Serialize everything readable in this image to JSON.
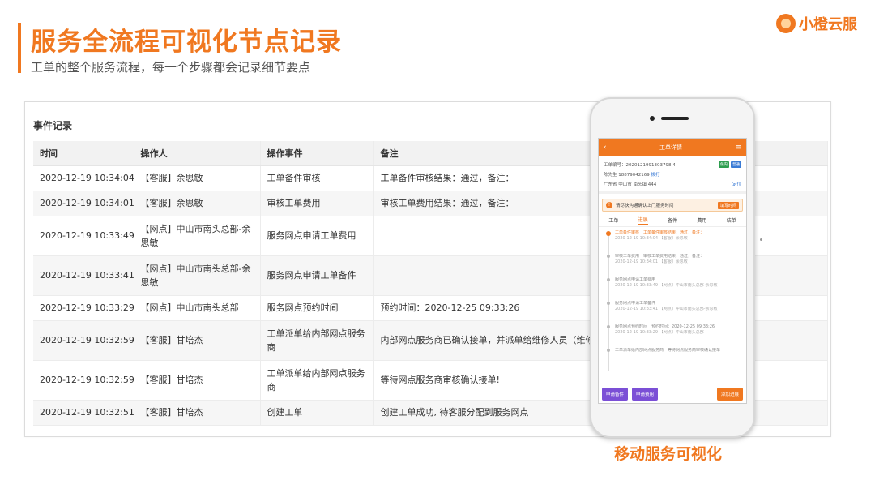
{
  "header": {
    "title": "服务全流程可视化节点记录",
    "subtitle": "工单的整个服务流程，每一个步骤都会记录细节要点",
    "brand": "小橙云服"
  },
  "events": {
    "title": "事件记录",
    "columns": [
      "时间",
      "操作人",
      "操作事件",
      "备注"
    ],
    "rows": [
      {
        "time": "2020-12-19 10:34:04",
        "operator": "【客服】余思敏",
        "event": "工单备件审核",
        "note": "工单备件审核结果：通过，备注："
      },
      {
        "time": "2020-12-19 10:34:01",
        "operator": "【客服】余思敏",
        "event": "审核工单费用",
        "note": "审核工单费用结果：通过，备注："
      },
      {
        "time": "2020-12-19 10:33:49",
        "operator": "【网点】中山市南头总部-余思敏",
        "event": "服务网点申请工单费用",
        "note": ""
      },
      {
        "time": "2020-12-19 10:33:41",
        "operator": "【网点】中山市南头总部-余思敏",
        "event": "服务网点申请工单备件",
        "note": ""
      },
      {
        "time": "2020-12-19 10:33:29",
        "operator": "【网点】中山市南头总部",
        "event": "服务网点预约时间",
        "note": "预约时间：2020-12-25 09:33:26"
      },
      {
        "time": "2020-12-19 10:32:59",
        "operator": "【客服】甘培杰",
        "event": "工单派单给内部网点服务商",
        "note": "内部网点服务商已确认接单，并派单给维修人员（维修"
      },
      {
        "time": "2020-12-19 10:32:59",
        "operator": "【客服】甘培杰",
        "event": "工单派单给内部网点服务商",
        "note": "等待网点服务商审核确认接单!"
      },
      {
        "time": "2020-12-19 10:32:51",
        "operator": "【客服】甘培杰",
        "event": "创建工单",
        "note": "创建工单成功, 待客服分配到服务网点"
      }
    ]
  },
  "mobile": {
    "app_title": "工单详情",
    "back_icon": "‹",
    "menu_icon": "≡",
    "order_no": "工单编号：2020121991303798 4",
    "tags": [
      {
        "label": "保内",
        "color": "#2e9e4f"
      },
      {
        "label": "普通",
        "color": "#3a7bd5"
      }
    ],
    "customer": "陈先生 18879042169",
    "call_label": "拨打",
    "address": "广东省 中山市 南头镇 444",
    "locate_label": "定位",
    "notice": "请尽快沟通确认上门服务时间",
    "notice_button": "填写时间",
    "tabs": [
      "工单",
      "进展",
      "备件",
      "费用",
      "结单"
    ],
    "active_tab": 1,
    "timeline": [
      {
        "desc": "工单备件审核　工单备件审核结果：通过，备注：",
        "meta": "2020-12-19 10:34:04 【客服】余思敏"
      },
      {
        "desc": "审核工单费用　审核工单费用结果：通过，备注：",
        "meta": "2020-12-19 10:34:01 【客服】余思敏"
      },
      {
        "desc": "服务网点申请工单费用",
        "meta": "2020-12-19 10:33:49 【网点】中山市南头总部-余思敏"
      },
      {
        "desc": "服务网点申请工单备件",
        "meta": "2020-12-19 10:33:41 【网点】中山市南头总部-余思敏"
      },
      {
        "desc": "服务网点预约时间　预约时间：2020-12-25 09:33:26",
        "meta": "2020-12-19 10:33:29 【网点】中山市南头总部"
      },
      {
        "desc": "工单派单给内部网点服务商　等待网点服务商审核确认接单",
        "meta": ""
      }
    ],
    "buttons": {
      "apply_parts": "申请备件",
      "apply_fee": "申请费用",
      "add_progress": "添加进展"
    }
  },
  "caption": "移动服务可视化"
}
